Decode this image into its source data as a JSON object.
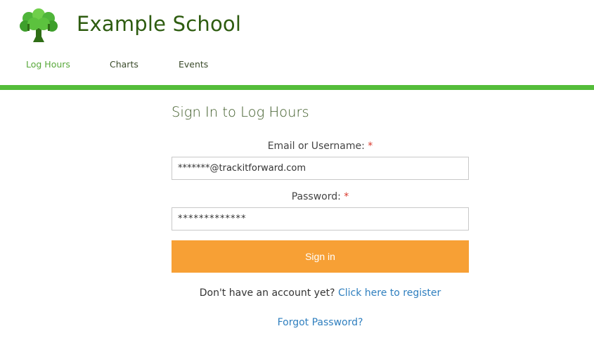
{
  "header": {
    "school_name": "Example School"
  },
  "nav": {
    "items": [
      {
        "label": "Log Hours",
        "active": true
      },
      {
        "label": "Charts",
        "active": false
      },
      {
        "label": "Events",
        "active": false
      }
    ]
  },
  "form": {
    "title": "Sign In to Log Hours",
    "email_label": "Email or Username:",
    "email_value": "*******@trackitforward.com",
    "password_label": "Password:",
    "password_value": "*************",
    "required_marker": "*",
    "signin_label": "Sign in",
    "register_prompt": "Don't have an account yet?",
    "register_link": "Click here to register",
    "forgot_link": "Forgot Password?"
  },
  "colors": {
    "brand_green": "#2e5c10",
    "accent_green": "#54bd3a",
    "button_orange": "#f7a035",
    "link_blue": "#2f7fbf",
    "required_red": "#d9382c"
  }
}
